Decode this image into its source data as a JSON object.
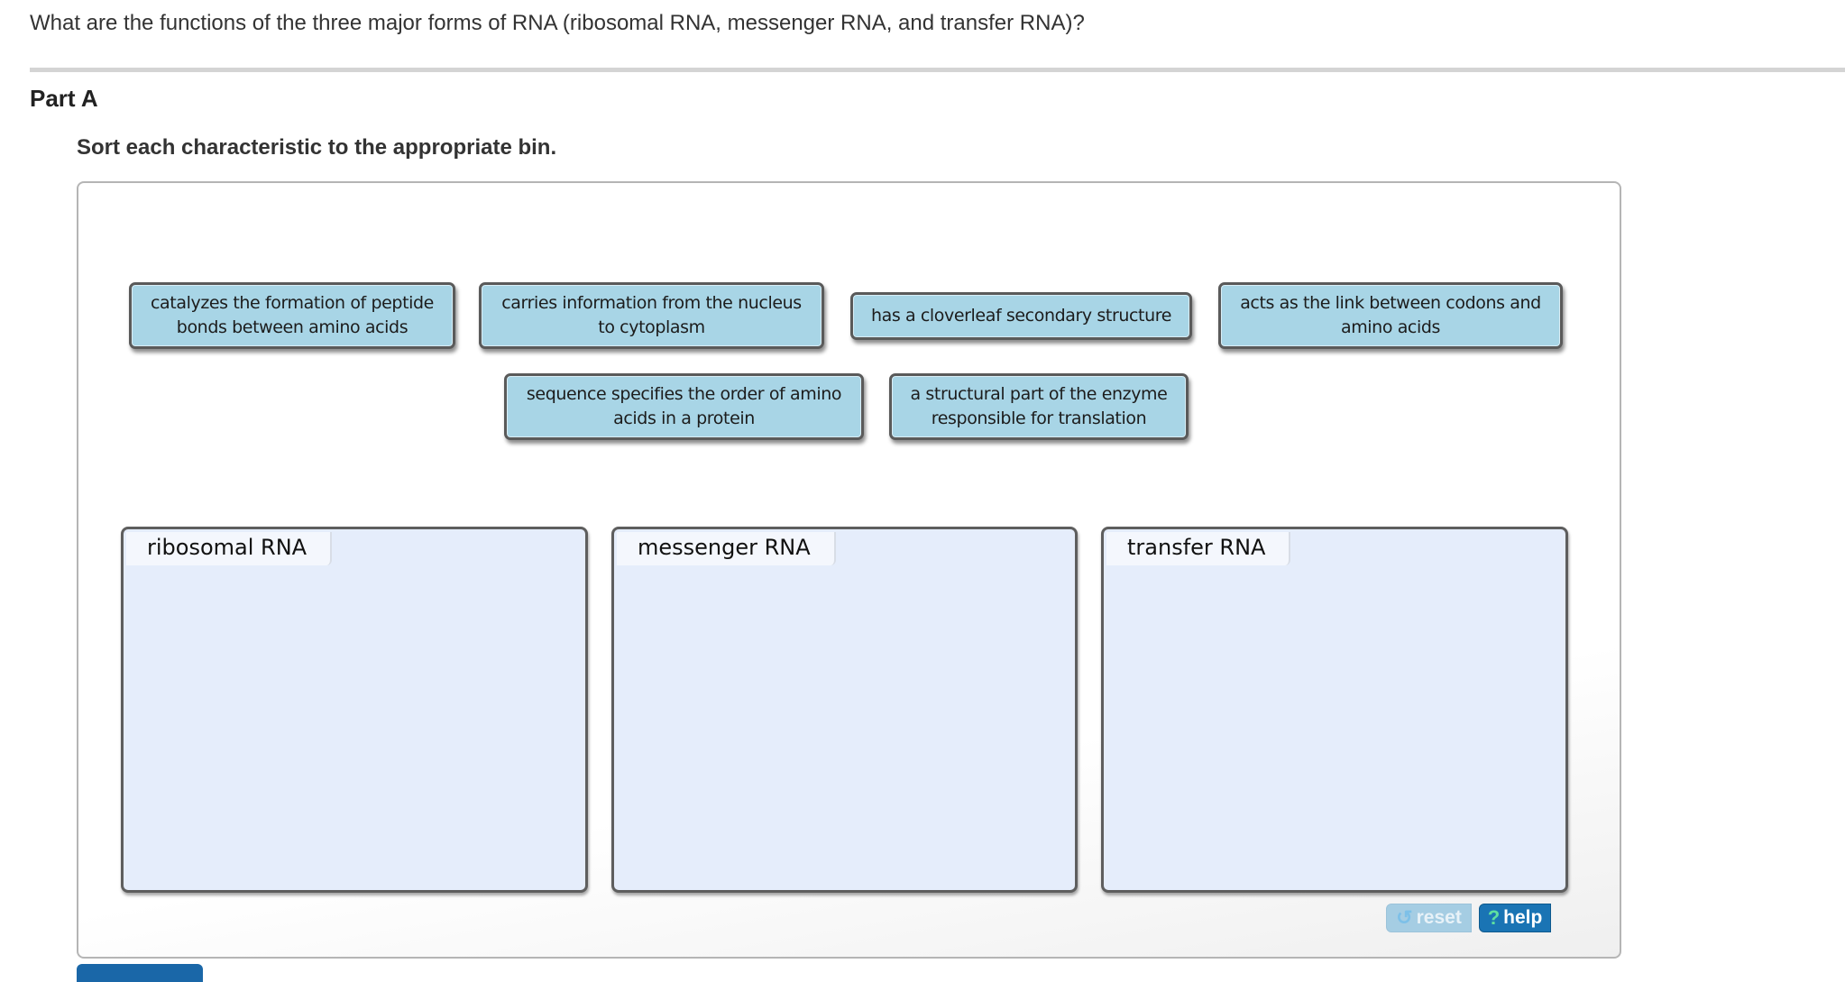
{
  "question": "What are the functions of the three major forms of RNA (ribosomal RNA, messenger RNA, and transfer RNA)?",
  "part_title": "Part A",
  "instruction": "Sort each characteristic to the appropriate bin.",
  "tiles": [
    {
      "line1": "catalyzes the formation of peptide",
      "line2": "bonds between amino acids"
    },
    {
      "line1": "carries information from the nucleus",
      "line2": "to cytoplasm"
    },
    {
      "line1": "has a cloverleaf secondary structure",
      "line2": ""
    },
    {
      "line1": "acts as the link between codons and",
      "line2": "amino acids"
    },
    {
      "line1": "sequence specifies the order of amino",
      "line2": "acids in a protein"
    },
    {
      "line1": "a structural part of the enzyme",
      "line2": "responsible for translation"
    }
  ],
  "bins": [
    {
      "label": "ribosomal RNA"
    },
    {
      "label": "messenger RNA"
    },
    {
      "label": "transfer RNA"
    }
  ],
  "buttons": {
    "reset_label": "reset",
    "reset_icon": "↺",
    "help_label": "help",
    "help_icon": "?"
  }
}
